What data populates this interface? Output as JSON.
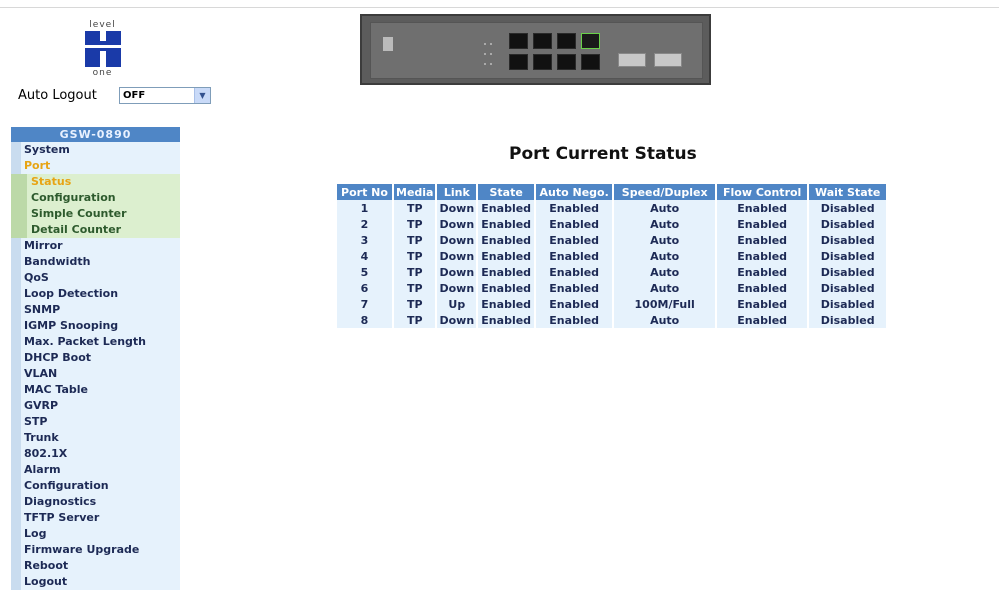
{
  "logo": {
    "top_text": "level",
    "bottom_text": "one"
  },
  "auto_logout": {
    "label": "Auto Logout",
    "value": "OFF"
  },
  "menu": {
    "header": "GSW-0890",
    "items": [
      {
        "label": "System",
        "type": "item"
      },
      {
        "label": "Port",
        "type": "item",
        "active": true
      },
      {
        "label": "Status",
        "type": "sub",
        "active": true
      },
      {
        "label": "Configuration",
        "type": "sub"
      },
      {
        "label": "Simple Counter",
        "type": "sub"
      },
      {
        "label": "Detail Counter",
        "type": "sub"
      },
      {
        "label": "Mirror",
        "type": "item"
      },
      {
        "label": "Bandwidth",
        "type": "item"
      },
      {
        "label": "QoS",
        "type": "item"
      },
      {
        "label": "Loop Detection",
        "type": "item"
      },
      {
        "label": "SNMP",
        "type": "item"
      },
      {
        "label": "IGMP Snooping",
        "type": "item"
      },
      {
        "label": "Max. Packet Length",
        "type": "item"
      },
      {
        "label": "DHCP Boot",
        "type": "item"
      },
      {
        "label": "VLAN",
        "type": "item"
      },
      {
        "label": "MAC Table",
        "type": "item"
      },
      {
        "label": "GVRP",
        "type": "item"
      },
      {
        "label": "STP",
        "type": "item"
      },
      {
        "label": "Trunk",
        "type": "item"
      },
      {
        "label": "802.1X",
        "type": "item"
      },
      {
        "label": "Alarm",
        "type": "item"
      },
      {
        "label": "Configuration",
        "type": "item"
      },
      {
        "label": "Diagnostics",
        "type": "item"
      },
      {
        "label": "TFTP Server",
        "type": "item"
      },
      {
        "label": "Log",
        "type": "item"
      },
      {
        "label": "Firmware Upgrade",
        "type": "item"
      },
      {
        "label": "Reboot",
        "type": "item"
      },
      {
        "label": "Logout",
        "type": "item"
      }
    ]
  },
  "main": {
    "title": "Port Current Status",
    "columns": [
      "Port No",
      "Media",
      "Link",
      "State",
      "Auto Nego.",
      "Speed/Duplex",
      "Flow Control",
      "Wait State"
    ],
    "rows": [
      [
        "1",
        "TP",
        "Down",
        "Enabled",
        "Enabled",
        "Auto",
        "Enabled",
        "Disabled"
      ],
      [
        "2",
        "TP",
        "Down",
        "Enabled",
        "Enabled",
        "Auto",
        "Enabled",
        "Disabled"
      ],
      [
        "3",
        "TP",
        "Down",
        "Enabled",
        "Enabled",
        "Auto",
        "Enabled",
        "Disabled"
      ],
      [
        "4",
        "TP",
        "Down",
        "Enabled",
        "Enabled",
        "Auto",
        "Enabled",
        "Disabled"
      ],
      [
        "5",
        "TP",
        "Down",
        "Enabled",
        "Enabled",
        "Auto",
        "Enabled",
        "Disabled"
      ],
      [
        "6",
        "TP",
        "Down",
        "Enabled",
        "Enabled",
        "Auto",
        "Enabled",
        "Disabled"
      ],
      [
        "7",
        "TP",
        "Up",
        "Enabled",
        "Enabled",
        "100M/Full",
        "Enabled",
        "Disabled"
      ],
      [
        "8",
        "TP",
        "Down",
        "Enabled",
        "Enabled",
        "Auto",
        "Enabled",
        "Disabled"
      ]
    ]
  }
}
